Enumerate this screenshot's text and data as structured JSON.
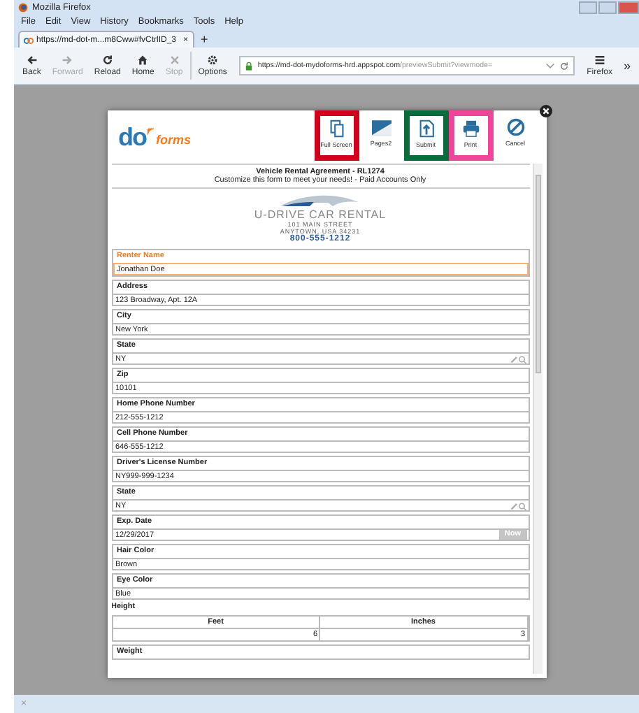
{
  "window": {
    "title": "Mozilla Firefox"
  },
  "menu": [
    "File",
    "Edit",
    "View",
    "History",
    "Bookmarks",
    "Tools",
    "Help"
  ],
  "tab": {
    "title": "https://md-dot-m...m8Cww#fvCtrlID_3",
    "close": "×",
    "new_tab": "+"
  },
  "toolbar": [
    {
      "label": "Back",
      "disabled": false
    },
    {
      "label": "Forward",
      "disabled": true
    },
    {
      "label": "Reload",
      "disabled": false
    },
    {
      "label": "Home",
      "disabled": false
    },
    {
      "label": "Stop",
      "disabled": true
    },
    {
      "label": "Options",
      "disabled": false
    }
  ],
  "address": {
    "host": "https://md-dot-mydoforms-hrd.appspot.com",
    "path": "/previewSubmit?viewmode="
  },
  "firefox_menu": "Firefox",
  "overflow": "»",
  "dialog": {
    "logo": {
      "prefix": "do",
      "suffix": "forms"
    },
    "actions": [
      {
        "label": "Full Screen",
        "color": "#d0021b"
      },
      {
        "label": "Pages2"
      },
      {
        "label": "Submit",
        "color": "#0b6b3a"
      },
      {
        "label": "Print",
        "color": "#f0449a"
      },
      {
        "label": "Cancel"
      }
    ],
    "form_title": "Vehicle Rental Agreement - RL1274",
    "form_subtitle": "Customize this form to meet your needs! - Paid Accounts Only",
    "company": {
      "name": "U-DRIVE CAR RENTAL",
      "street": "101 MAIN STREET",
      "city": "ANYTOWN, USA 34231",
      "phone": "800-555-1212"
    },
    "fields": [
      {
        "kind": "text",
        "label": "Renter Name",
        "value": "Jonathan Doe",
        "focused": true
      },
      {
        "kind": "text",
        "label": "Address",
        "value": "123 Broadway, Apt. 12A",
        "focused": false
      },
      {
        "kind": "text",
        "label": "City",
        "value": "New York",
        "focused": false
      },
      {
        "kind": "lookup",
        "label": "State",
        "value": "NY",
        "focused": false
      },
      {
        "kind": "text",
        "label": "Zip",
        "value": "10101",
        "focused": false
      },
      {
        "kind": "text",
        "label": "Home Phone Number",
        "value": "212-555-1212",
        "focused": false
      },
      {
        "kind": "text",
        "label": "Cell Phone Number",
        "value": "646-555-1212",
        "focused": false
      },
      {
        "kind": "text",
        "label": "Driver's License Number",
        "value": "NY999-999-1234",
        "focused": false
      },
      {
        "kind": "lookup",
        "label": "State",
        "value": "NY",
        "focused": false
      },
      {
        "kind": "date",
        "label": "Exp. Date",
        "value": "12/29/2017",
        "button": "Now",
        "focused": false
      },
      {
        "kind": "text",
        "label": "Hair Color",
        "value": "Brown",
        "focused": false
      },
      {
        "kind": "text",
        "label": "Eye Color",
        "value": "Blue",
        "focused": false
      }
    ],
    "height": {
      "label": "Height",
      "columns": [
        "Feet",
        "Inches"
      ],
      "values": [
        "6",
        "3"
      ]
    },
    "weight": {
      "label": "Weight"
    }
  },
  "status_bar": {
    "close": "×"
  }
}
